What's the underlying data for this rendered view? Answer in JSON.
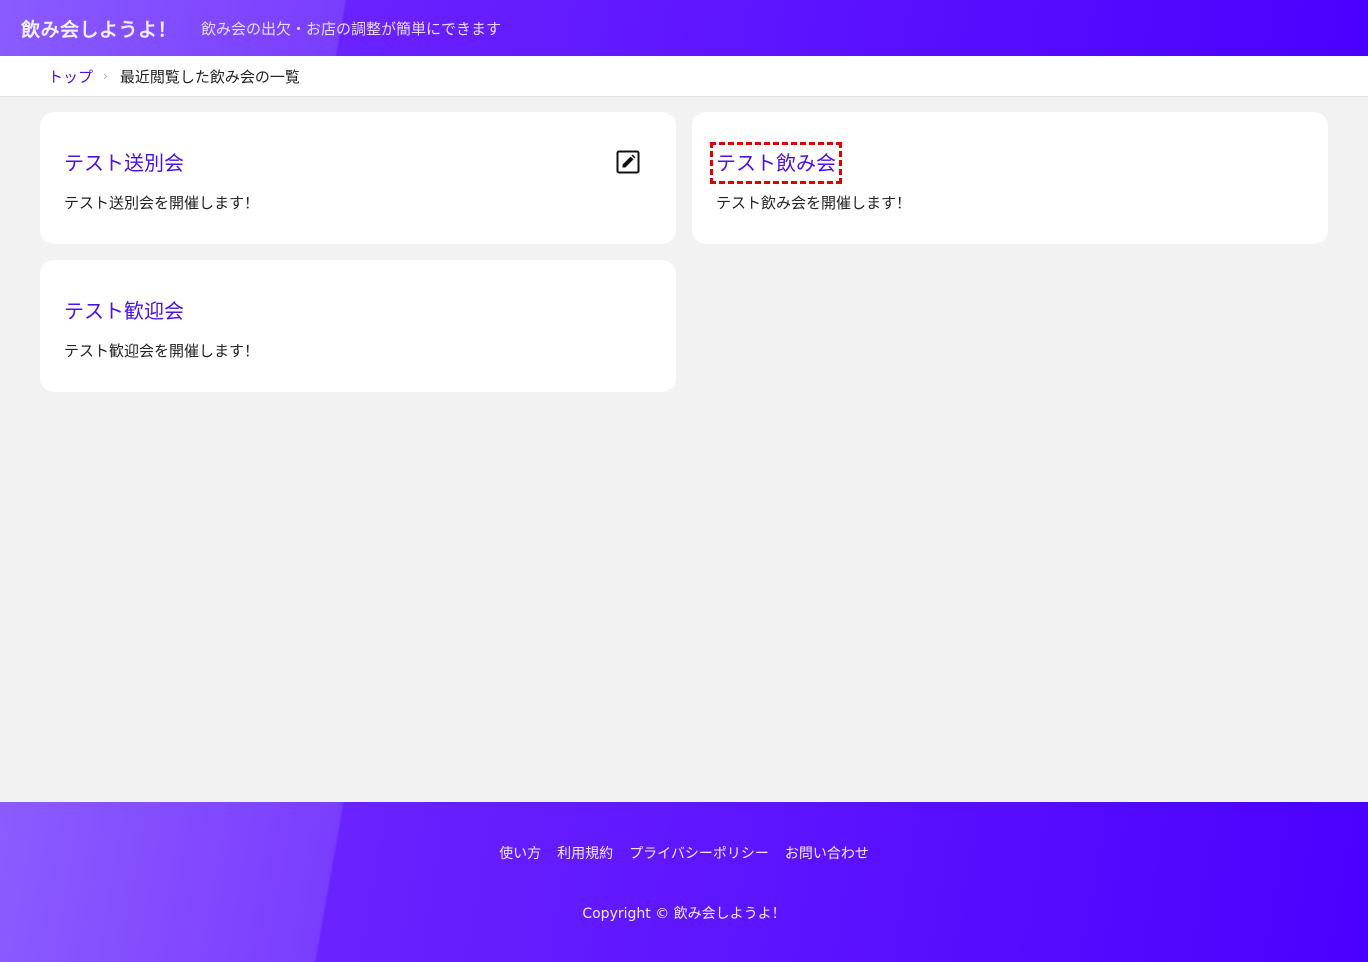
{
  "header": {
    "title": "飲み会しようよ！",
    "tagline": "飲み会の出欠・お店の調整が簡単にできます"
  },
  "breadcrumb": {
    "home": "トップ",
    "separator": "›",
    "current": "最近閲覧した飲み会の一覧"
  },
  "cards": [
    {
      "title": "テスト送別会",
      "description": "テスト送別会を開催します！",
      "icon": "edit-icon"
    },
    {
      "title": "テスト飲み会",
      "description": "テスト飲み会を開催します！"
    },
    {
      "title": "テスト歓迎会",
      "description": "テスト歓迎会を開催します！"
    }
  ],
  "footer": {
    "links": [
      "使い方",
      "利用規約",
      "プライバシーポリシー",
      "お問い合わせ"
    ],
    "copyright": "Copyright © 飲み会しようよ！"
  },
  "colors": {
    "accent": "#4b12e8",
    "header_gradient_start": "#8a5cff",
    "header_gradient_end": "#4a00ff",
    "highlight": "#e00000"
  }
}
